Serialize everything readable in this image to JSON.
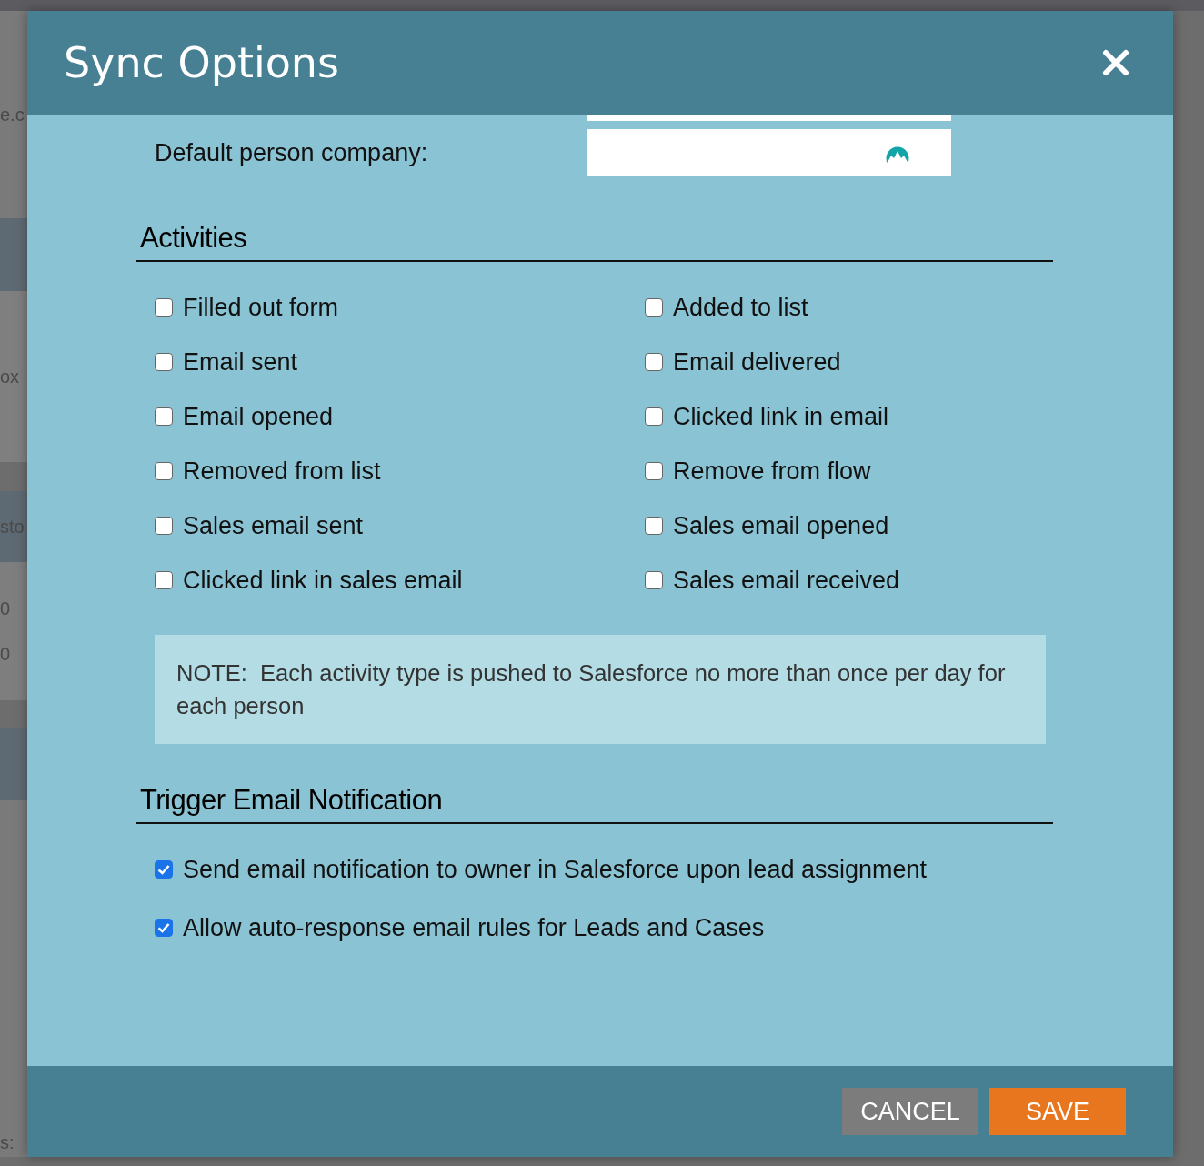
{
  "backdrop_texts": [
    "e.c",
    "ox",
    "sto",
    "0",
    "0",
    "s:"
  ],
  "dialog": {
    "title": "Sync Options",
    "default_company": {
      "label": "Default person company:"
    },
    "activities": {
      "heading": "Activities",
      "items": [
        {
          "label": "Filled out form",
          "checked": false
        },
        {
          "label": "Added to list",
          "checked": false
        },
        {
          "label": "Email sent",
          "checked": false
        },
        {
          "label": "Email delivered",
          "checked": false
        },
        {
          "label": "Email opened",
          "checked": false
        },
        {
          "label": "Clicked link in email",
          "checked": false
        },
        {
          "label": "Removed from list",
          "checked": false
        },
        {
          "label": "Remove from flow",
          "checked": false
        },
        {
          "label": "Sales email sent",
          "checked": false
        },
        {
          "label": "Sales email opened",
          "checked": false
        },
        {
          "label": "Clicked link in sales email",
          "checked": false
        },
        {
          "label": "Sales email received",
          "checked": false
        }
      ]
    },
    "note": "NOTE:  Each activity type is pushed to Salesforce no more than once per day for each person",
    "trigger": {
      "heading": "Trigger Email Notification",
      "items": [
        {
          "label": "Send email notification to owner in Salesforce upon lead assignment",
          "checked": true
        },
        {
          "label": "Allow auto-response email rules for Leads and Cases",
          "checked": true
        }
      ]
    },
    "buttons": [
      {
        "label": "CANCEL",
        "kind": "secondary"
      },
      {
        "label": "SAVE",
        "kind": "primary"
      }
    ]
  }
}
